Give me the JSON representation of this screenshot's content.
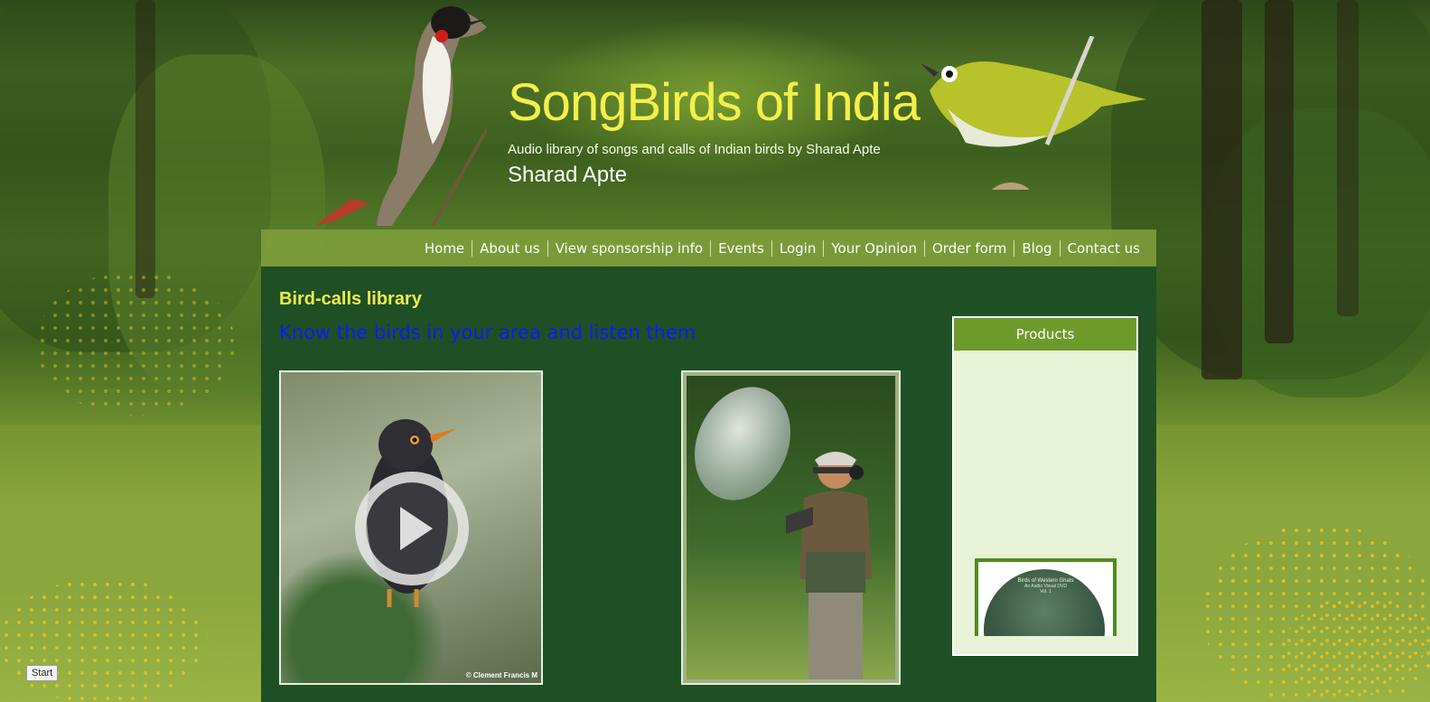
{
  "site": {
    "title": "SongBirds of India",
    "tagline": "Audio library of songs and calls of Indian birds by Sharad Apte",
    "author": "Sharad Apte"
  },
  "nav": {
    "items": [
      "Home",
      "About us",
      "View sponsorship info",
      "Events",
      "Login",
      "Your Opinion",
      "Order form",
      "Blog",
      "Contact us"
    ]
  },
  "main": {
    "section_title": "Bird-calls library",
    "subtitle": "Know the birds in your area and listen them",
    "video_copyright": "© Clement Francis M"
  },
  "sidebar": {
    "heading": "Products",
    "product": {
      "title": "Birds of Western Ghats",
      "subtitle": "An Audio Visual DVD",
      "vol": "Vol. 1"
    }
  },
  "widgets": {
    "start_label": "Start"
  },
  "colors": {
    "title": "#f4ef4a",
    "nav_bg": "#80a03c",
    "content_bg": "#1f4f24",
    "subtitle": "#0a1cff",
    "sidebar_head": "#6e9a2c",
    "sidebar_bg": "#e8f2d6"
  }
}
